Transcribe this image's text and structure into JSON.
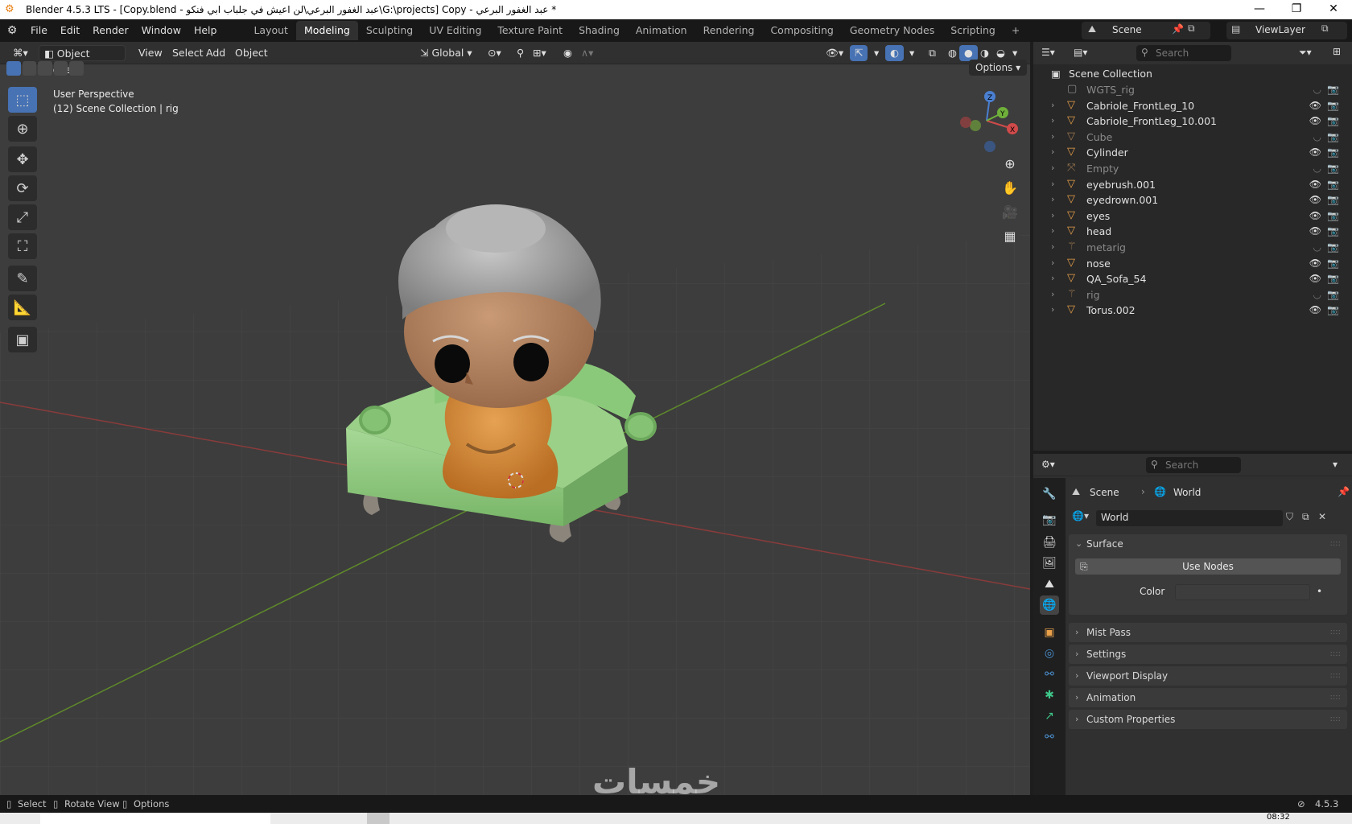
{
  "window": {
    "title": "* عبد الغفور البرعي - Copy [G:\\projects\\عبد الغفور البرعي\\لن اعيش في جلباب ابي فنكو - Copy.blend] - Blender 4.5.3 LTS",
    "minimize": "—",
    "maximize": "❐",
    "close": "✕"
  },
  "menubar": {
    "items": [
      "File",
      "Edit",
      "Render",
      "Window",
      "Help"
    ],
    "workspaces": [
      "Layout",
      "Modeling",
      "Sculpting",
      "UV Editing",
      "Texture Paint",
      "Shading",
      "Animation",
      "Rendering",
      "Compositing",
      "Geometry Nodes",
      "Scripting"
    ],
    "active_workspace": "Modeling",
    "add_tab": "+",
    "scene_label": "Scene",
    "viewlayer_label": "ViewLayer"
  },
  "viewport": {
    "mode": "Object Mode",
    "menus": [
      "View",
      "Select",
      "Add",
      "Object"
    ],
    "transform_orientation": "Global",
    "options_label": "Options",
    "overlay_title": "User Perspective",
    "overlay_subtitle": "(12) Scene Collection | rig",
    "gizmo": {
      "z": "Z",
      "y": "Y",
      "x": "X"
    }
  },
  "outliner": {
    "search_placeholder": "Search",
    "root": "Scene Collection",
    "items": [
      {
        "name": "WGTS_rig",
        "dim": true,
        "type": "collection"
      },
      {
        "name": "Cabriole_FrontLeg_10",
        "dim": false,
        "type": "mesh"
      },
      {
        "name": "Cabriole_FrontLeg_10.001",
        "dim": false,
        "type": "mesh"
      },
      {
        "name": "Cube",
        "dim": true,
        "type": "mesh"
      },
      {
        "name": "Cylinder",
        "dim": false,
        "type": "mesh"
      },
      {
        "name": "Empty",
        "dim": true,
        "type": "empty"
      },
      {
        "name": "eyebrush.001",
        "dim": false,
        "type": "mesh"
      },
      {
        "name": "eyedrown.001",
        "dim": false,
        "type": "mesh"
      },
      {
        "name": "eyes",
        "dim": false,
        "type": "mesh"
      },
      {
        "name": "head",
        "dim": false,
        "type": "mesh"
      },
      {
        "name": "metarig",
        "dim": true,
        "type": "armature"
      },
      {
        "name": "nose",
        "dim": false,
        "type": "mesh"
      },
      {
        "name": "QA_Sofa_54",
        "dim": false,
        "type": "mesh"
      },
      {
        "name": "rig",
        "dim": true,
        "type": "armature"
      },
      {
        "name": "Torus.002",
        "dim": false,
        "type": "mesh"
      }
    ],
    "rig_badge": "12"
  },
  "properties": {
    "search_placeholder": "Search",
    "breadcrumb": [
      "Scene",
      "World"
    ],
    "world_name": "World",
    "panels": {
      "surface": "Surface",
      "use_nodes": "Use Nodes",
      "color_label": "Color",
      "mist_pass": "Mist Pass",
      "settings": "Settings",
      "viewport_display": "Viewport Display",
      "animation": "Animation",
      "custom_properties": "Custom Properties"
    }
  },
  "statusbar": {
    "select": "Select",
    "rotate_view": "Rotate View",
    "options": "Options",
    "version": "4.5.3"
  },
  "taskbar": {
    "time": "08:32"
  },
  "watermark": "خمسات",
  "colors": {
    "accent": "#4772b3",
    "object_orange": "#e8a04a",
    "mesh_green": "#3fc88a"
  }
}
